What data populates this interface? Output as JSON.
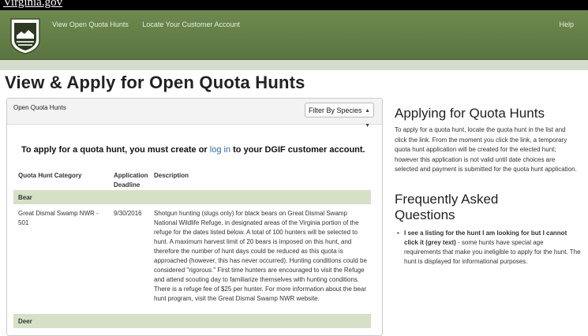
{
  "topbar": {
    "site": "Virginia.gov"
  },
  "header": {
    "nav": [
      "View Open Quota Hunts",
      "Locate Your Customer Account"
    ],
    "help": "Help"
  },
  "page": {
    "title": "View & Apply for Open Quota Hunts"
  },
  "panel": {
    "title": "Open Quota Hunts",
    "filter": "Filter By Species",
    "cta_prefix": "To apply for a quota hunt, you must create or",
    "cta_link": "log in",
    "cta_suffix": "to your DGIF customer account.",
    "columns": {
      "category": "Quota Hunt Category",
      "deadline": "Application Deadline",
      "description": "Description"
    },
    "groups": [
      {
        "name": "Bear"
      },
      {
        "name": "Deer"
      }
    ],
    "rows": [
      {
        "category": "Great Dismal Swamp NWR - 501",
        "deadline": "9/30/2016",
        "description": "Shotgun hunting (slugs only) for black bears on Great Dismal Swamp National Wildlife Refuge, in designated areas of the Virginia portion of the refuge for the dates listed below. A total of 100 hunters will be selected to hunt. A maximum harvest limit of 20 bears is imposed on this hunt, and therefore the number of hunt days could be reduced as this quota is approached (however, this has never occurred). Hunting conditions could be considered \"rigorous.\" First time hunters are encouraged to visit the Refuge and attend scouting day to familiarize themselves with hunting conditions. There is a refuge fee of $25 per hunter. For more information about the bear hunt program, visit the Great Dismal Swamp NWR website."
      }
    ]
  },
  "sidebar": {
    "h1": "Applying for Quota Hunts",
    "p1": "To apply for a quota hunt, locate the quota hunt in the list and click the link. From the moment you click the link, a temporary quota hunt application will be created for the elected hunt; however this application is not valid until date choices are selected and payment is submitted for the quota hunt application.",
    "h2": "Frequently Asked Questions",
    "faq_bold": "I see a listing for the hunt I am looking for but I cannot click it (grey text)",
    "faq_text": " - some hunts have special age requirements that make you ineligible to apply for the hunt. The hunt is displayed for informational purposes."
  }
}
